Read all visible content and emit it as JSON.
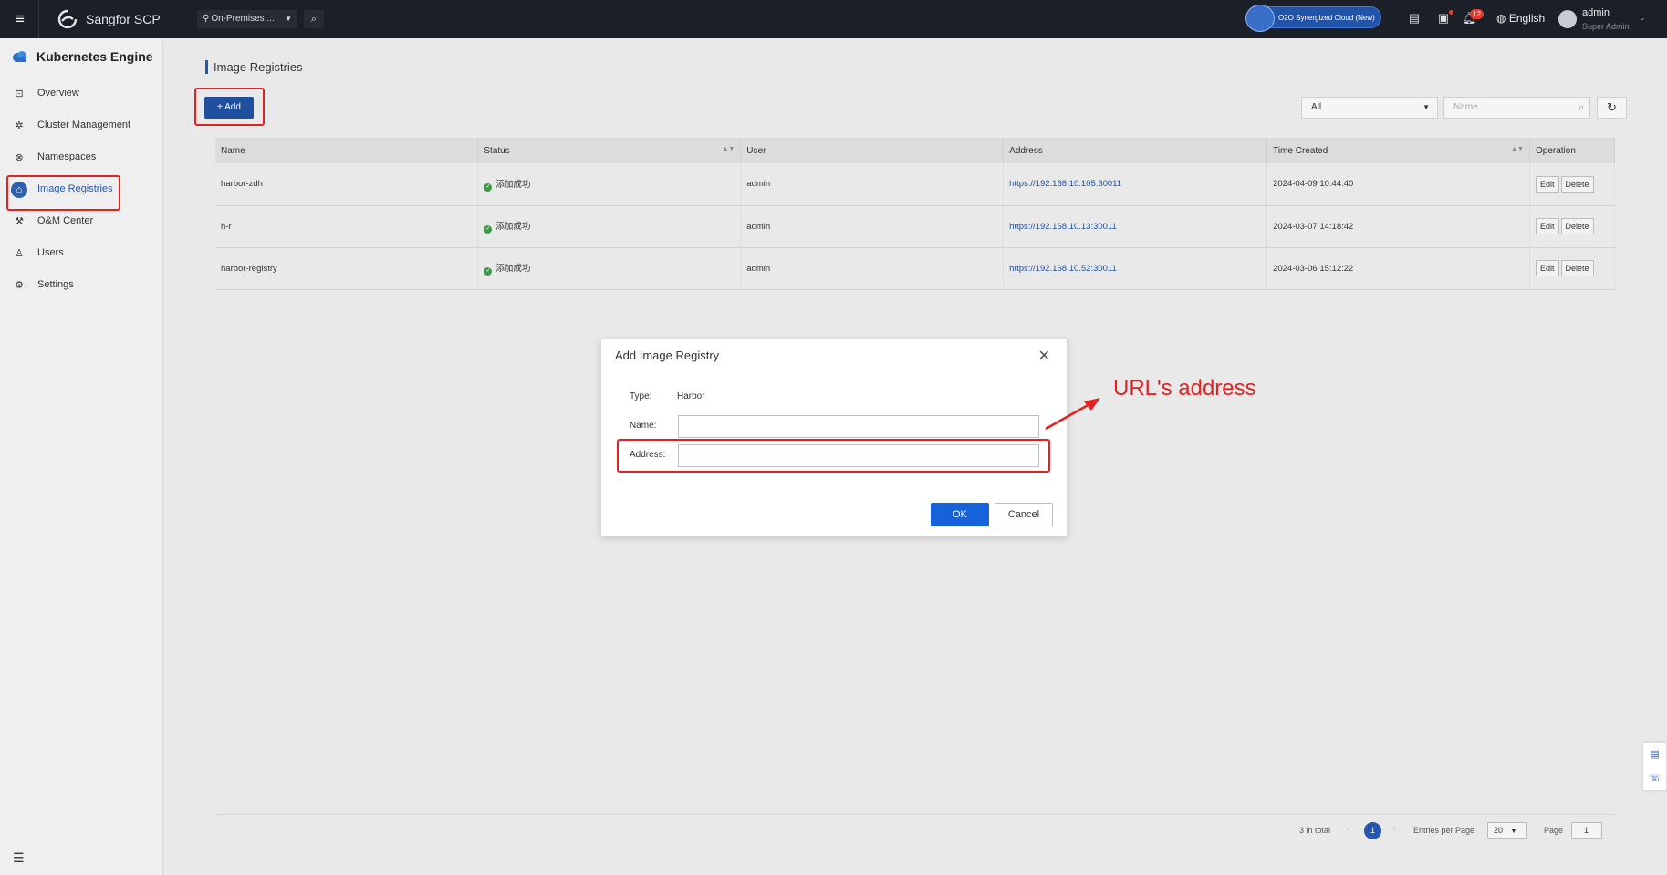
{
  "topbar": {
    "brand": "Sangfor SCP",
    "env_selector": "On-Premises ...",
    "o2o_label": "O2O Synergized Cloud (New)",
    "notification_count": "12",
    "language": "English",
    "user_name": "admin",
    "user_role": "Super Admin"
  },
  "sidebar": {
    "title": "Kubernetes Engine",
    "items": [
      {
        "label": "Overview",
        "icon": "monitor-icon"
      },
      {
        "label": "Cluster Management",
        "icon": "cluster-icon"
      },
      {
        "label": "Namespaces",
        "icon": "namespace-icon"
      },
      {
        "label": "Image Registries",
        "icon": "registry-icon"
      },
      {
        "label": "O&M Center",
        "icon": "wrench-icon"
      },
      {
        "label": "Users",
        "icon": "user-icon"
      },
      {
        "label": "Settings",
        "icon": "settings-icon"
      }
    ]
  },
  "page": {
    "title": "Image Registries",
    "add_label": "Add",
    "filter_value": "All",
    "search_placeholder": "Name"
  },
  "table": {
    "columns": [
      "Name",
      "Status",
      "User",
      "Address",
      "Time Created",
      "Operation"
    ],
    "rows": [
      {
        "name": "harbor-zdh",
        "status": "添加成功",
        "user": "admin",
        "address": "https://192.168.10.105:30011",
        "time": "2024-04-09 10:44:40",
        "edit": "Edit",
        "delete": "Delete"
      },
      {
        "name": "h-r",
        "status": "添加成功",
        "user": "admin",
        "address": "https://192.168.10.13:30011",
        "time": "2024-03-07 14:18:42",
        "edit": "Edit",
        "delete": "Delete"
      },
      {
        "name": "harbor-registry",
        "status": "添加成功",
        "user": "admin",
        "address": "https://192.168.10.52:30011",
        "time": "2024-03-06 15:12:22",
        "edit": "Edit",
        "delete": "Delete"
      }
    ]
  },
  "pagination": {
    "total": "3 in total",
    "current_page": "1",
    "entries_label": "Entries per Page",
    "entries_value": "20",
    "page_label": "Page",
    "page_value": "1"
  },
  "modal": {
    "title": "Add Image Registry",
    "type_label": "Type:",
    "type_value": "Harbor",
    "name_label": "Name:",
    "name_value": "",
    "address_label": "Address:",
    "address_value": "",
    "ok_label": "OK",
    "cancel_label": "Cancel"
  },
  "annotation": {
    "text": "URL's address",
    "color": "#e02222"
  },
  "colors": {
    "topbar_bg": "#1b1f27",
    "accent": "#2458b0",
    "primary_button": "#1562db",
    "success": "#3c9a4a"
  }
}
